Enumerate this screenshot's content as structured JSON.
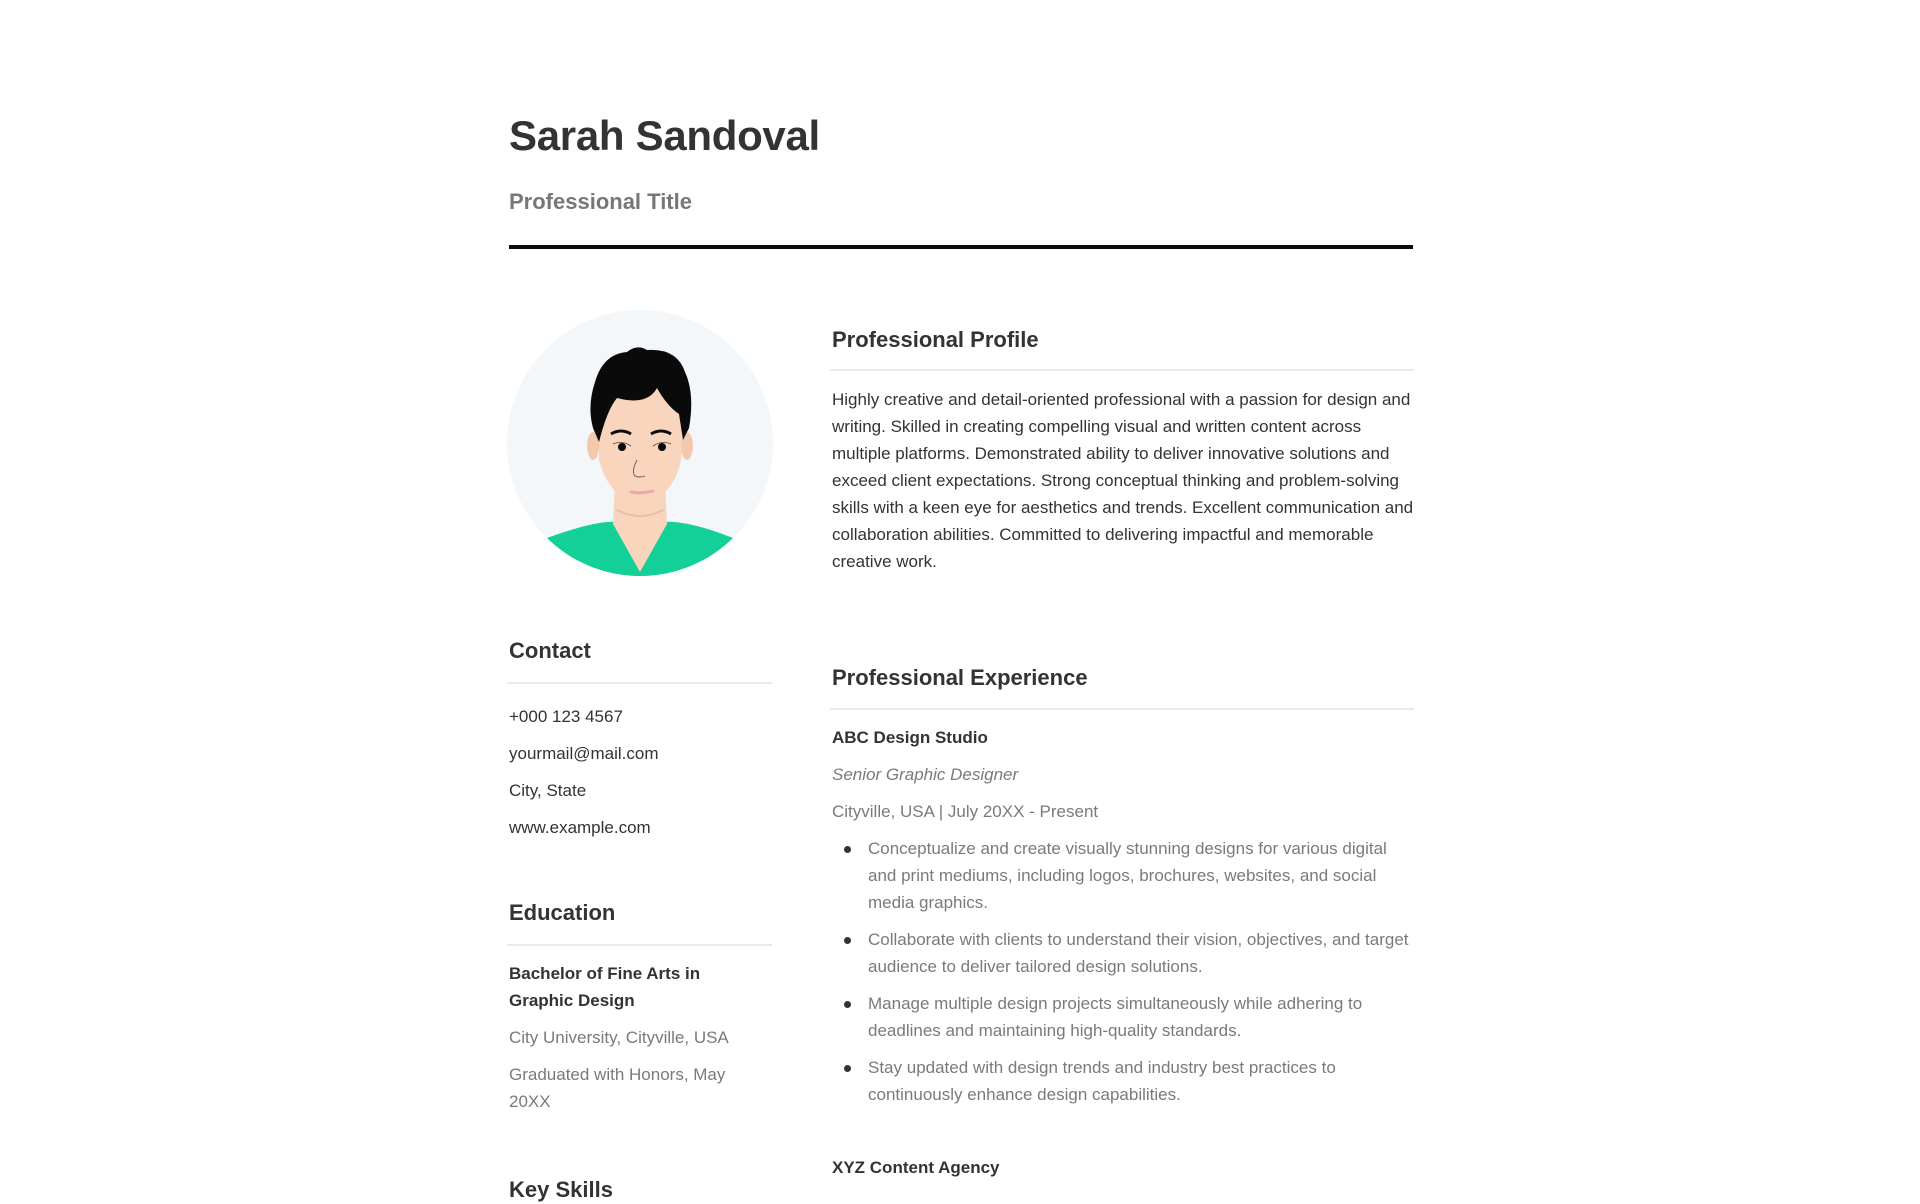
{
  "header": {
    "name": "Sarah Sandoval",
    "title": "Professional Title"
  },
  "avatar": {
    "description": "Illustrated portrait of a person with short black hair wearing a green shirt",
    "colors": {
      "background": "#f4f7fa",
      "hair": "#0a0a0a",
      "skin": "#f8d5bc",
      "shirt": "#13cf98"
    }
  },
  "contact": {
    "heading": "Contact",
    "items": [
      {
        "type": "phone",
        "value": " +000 123 4567"
      },
      {
        "type": "email",
        "value": "yourmail@mail.com"
      },
      {
        "type": "location",
        "value": "City, State"
      },
      {
        "type": "website",
        "value": "www.example.com"
      }
    ]
  },
  "education": {
    "heading": "Education",
    "degree": "Bachelor of Fine Arts in Graphic Design",
    "school": "City University, Cityville, USA",
    "honors": "Graduated with Honors, May 20XX"
  },
  "skills": {
    "heading": "Key Skills"
  },
  "profile": {
    "heading": "Professional Profile",
    "text": "Highly creative and detail-oriented professional with a passion for design and writing. Skilled in creating compelling visual and written content across multiple platforms. Demonstrated ability to deliver innovative solutions and exceed client expectations. Strong conceptual thinking and problem-solving skills with a keen eye for aesthetics and trends. Excellent communication and collaboration abilities. Committed to delivering impactful and memorable creative work."
  },
  "experience": {
    "heading": "Professional Experience",
    "jobs": [
      {
        "company": "ABC Design Studio",
        "role": "Senior Graphic Designer",
        "meta": "Cityville, USA | July 20XX - Present",
        "bullets": [
          "Conceptualize and create visually stunning designs for various digital and print mediums, including logos, brochures, websites, and social media graphics.",
          "Collaborate with clients to understand their vision, objectives, and target audience to deliver tailored design solutions.",
          "Manage multiple design projects simultaneously while adhering to deadlines and maintaining high-quality standards.",
          "Stay updated with design trends and industry best practices to continuously enhance design capabilities."
        ]
      },
      {
        "company": "XYZ Content Agency"
      }
    ]
  }
}
